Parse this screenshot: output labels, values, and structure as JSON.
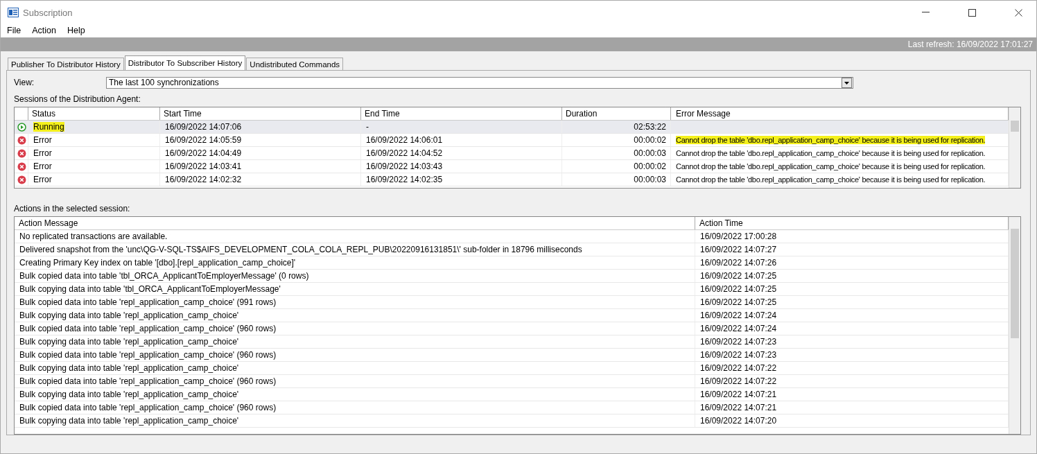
{
  "window": {
    "title": "Subscription"
  },
  "menu": [
    "File",
    "Action",
    "Help"
  ],
  "status_bar": {
    "last_refresh": "Last refresh: 16/09/2022 17:01:27"
  },
  "tabs": [
    {
      "label": "Publisher To Distributor History",
      "selected": false
    },
    {
      "label": "Distributor To Subscriber History",
      "selected": true
    },
    {
      "label": "Undistributed Commands",
      "selected": false
    }
  ],
  "view": {
    "label": "View:",
    "value": "The last 100 synchronizations"
  },
  "sessions": {
    "label": "Sessions of the Distribution Agent:",
    "columns": [
      "Status",
      "Start Time",
      "End Time",
      "Duration",
      "Error Message"
    ],
    "rows": [
      {
        "kind": "running",
        "status": "Running",
        "start": "16/09/2022 14:07:06",
        "end": "-",
        "duration": "02:53:22",
        "error": "",
        "selected": true,
        "highlight_status": true
      },
      {
        "kind": "error",
        "status": "Error",
        "start": "16/09/2022 14:05:59",
        "end": "16/09/2022 14:06:01",
        "duration": "00:00:02",
        "error": "Cannot drop the table 'dbo.repl_application_camp_choice' because it is being used for replication.",
        "selected": false,
        "highlight_status": false,
        "highlight_error": true
      },
      {
        "kind": "error",
        "status": "Error",
        "start": "16/09/2022 14:04:49",
        "end": "16/09/2022 14:04:52",
        "duration": "00:00:03",
        "error": "Cannot drop the table 'dbo.repl_application_camp_choice' because it is being used for replication.",
        "selected": false,
        "highlight_status": false,
        "highlight_error": false
      },
      {
        "kind": "error",
        "status": "Error",
        "start": "16/09/2022 14:03:41",
        "end": "16/09/2022 14:03:43",
        "duration": "00:00:02",
        "error": "Cannot drop the table 'dbo.repl_application_camp_choice' because it is being used for replication.",
        "selected": false,
        "highlight_status": false,
        "highlight_error": false
      },
      {
        "kind": "error",
        "status": "Error",
        "start": "16/09/2022 14:02:32",
        "end": "16/09/2022 14:02:35",
        "duration": "00:00:03",
        "error": "Cannot drop the table 'dbo.repl_application_camp_choice' because it is being used for replication.",
        "selected": false,
        "highlight_status": false,
        "highlight_error": false
      }
    ]
  },
  "actions": {
    "label": "Actions in the selected session:",
    "columns": [
      "Action Message",
      "Action Time"
    ],
    "rows": [
      {
        "message": "No replicated transactions are available.",
        "time": "16/09/2022 17:00:28"
      },
      {
        "message": "Delivered snapshot from the 'unc\\QG-V-SQL-TS$AIFS_DEVELOPMENT_COLA_COLA_REPL_PUB\\20220916131851\\' sub-folder in 18796 milliseconds",
        "time": "16/09/2022 14:07:27"
      },
      {
        "message": "Creating Primary Key index on table '[dbo].[repl_application_camp_choice]'",
        "time": "16/09/2022 14:07:26"
      },
      {
        "message": "Bulk copied data into table 'tbl_ORCA_ApplicantToEmployerMessage' (0 rows)",
        "time": "16/09/2022 14:07:25"
      },
      {
        "message": "Bulk copying data into table 'tbl_ORCA_ApplicantToEmployerMessage'",
        "time": "16/09/2022 14:07:25"
      },
      {
        "message": "Bulk copied data into table 'repl_application_camp_choice' (991 rows)",
        "time": "16/09/2022 14:07:25"
      },
      {
        "message": "Bulk copying data into table 'repl_application_camp_choice'",
        "time": "16/09/2022 14:07:24"
      },
      {
        "message": "Bulk copied data into table 'repl_application_camp_choice' (960 rows)",
        "time": "16/09/2022 14:07:24"
      },
      {
        "message": "Bulk copying data into table 'repl_application_camp_choice'",
        "time": "16/09/2022 14:07:23"
      },
      {
        "message": "Bulk copied data into table 'repl_application_camp_choice' (960 rows)",
        "time": "16/09/2022 14:07:23"
      },
      {
        "message": "Bulk copying data into table 'repl_application_camp_choice'",
        "time": "16/09/2022 14:07:22"
      },
      {
        "message": "Bulk copied data into table 'repl_application_camp_choice' (960 rows)",
        "time": "16/09/2022 14:07:22"
      },
      {
        "message": "Bulk copying data into table 'repl_application_camp_choice'",
        "time": "16/09/2022 14:07:21"
      },
      {
        "message": "Bulk copied data into table 'repl_application_camp_choice' (960 rows)",
        "time": "16/09/2022 14:07:21"
      },
      {
        "message": "Bulk copying data into table 'repl_application_camp_choice'",
        "time": "16/09/2022 14:07:20"
      }
    ]
  }
}
